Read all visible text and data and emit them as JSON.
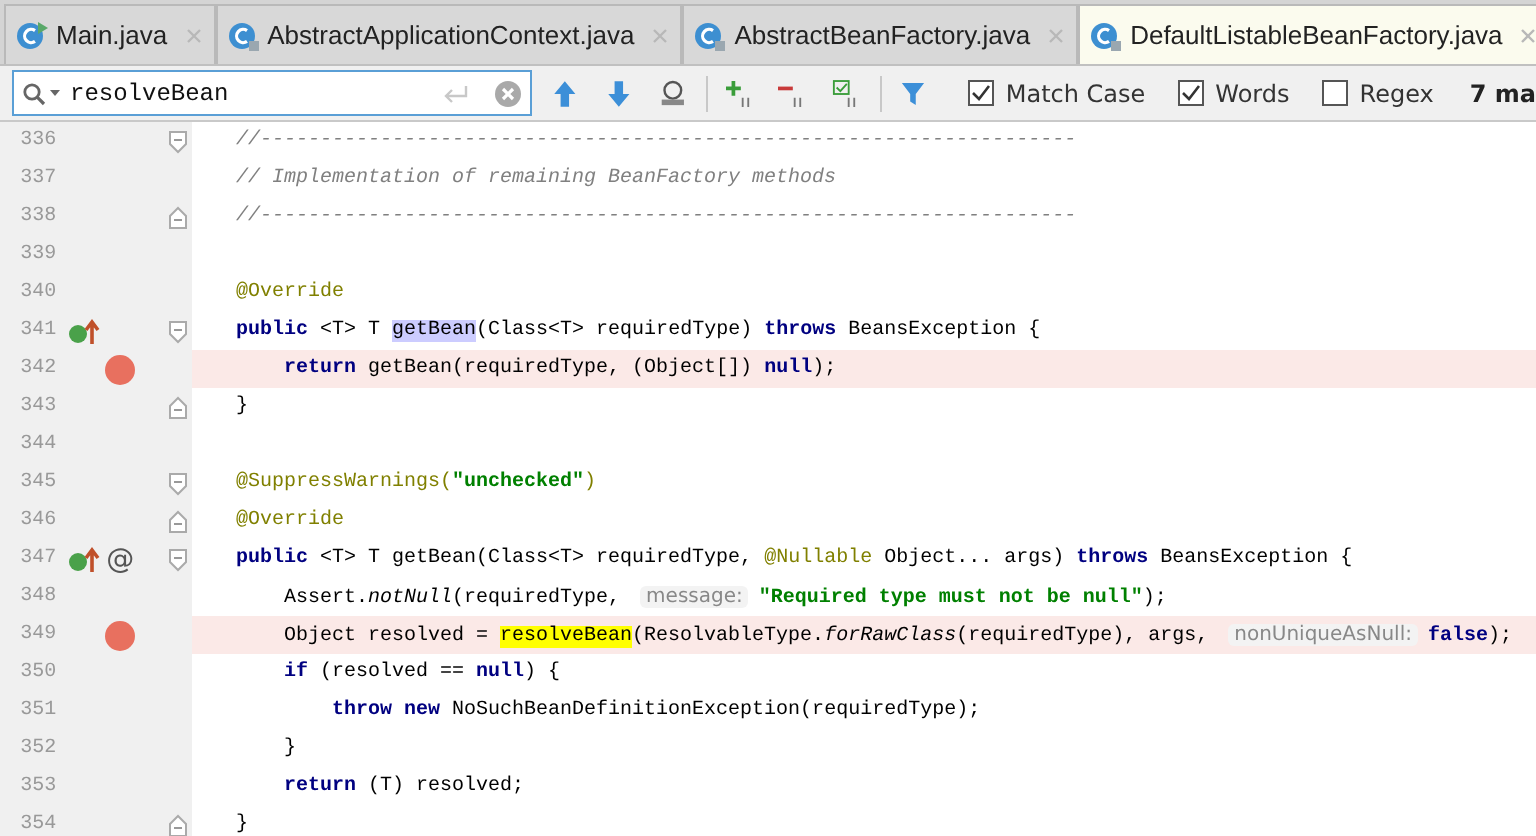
{
  "tabs": [
    {
      "label": "Main.java",
      "selected": false
    },
    {
      "label": "AbstractApplicationContext.java",
      "selected": false
    },
    {
      "label": "AbstractBeanFactory.java",
      "selected": false
    },
    {
      "label": "DefaultListableBeanFactory.java",
      "selected": true
    }
  ],
  "search": {
    "value": "resolveBean",
    "options": [
      {
        "label": "Match Case",
        "checked": true
      },
      {
        "label": "Words",
        "checked": true
      },
      {
        "label": "Regex",
        "checked": false
      }
    ],
    "result": "7 ma"
  },
  "editor": {
    "lines": [
      {
        "number": "336",
        "breakpoint": false,
        "gutter": [
          {
            "kind": "fold-start"
          }
        ],
        "tokens": [
          {
            "kind": "comment",
            "text": "//--------------------------------------------------------------------"
          }
        ]
      },
      {
        "number": "337",
        "breakpoint": false,
        "tokens": [
          {
            "kind": "comment",
            "text": "// Implementation of remaining BeanFactory methods"
          }
        ]
      },
      {
        "number": "338",
        "breakpoint": false,
        "gutter": [
          {
            "kind": "fold-end"
          }
        ],
        "tokens": [
          {
            "kind": "comment",
            "text": "//--------------------------------------------------------------------"
          }
        ]
      },
      {
        "number": "339",
        "breakpoint": false
      },
      {
        "number": "340",
        "breakpoint": false,
        "tokens": [
          {
            "kind": "annotation",
            "text": "@Override"
          }
        ]
      },
      {
        "number": "341",
        "breakpoint": false,
        "gutter": [
          {
            "kind": "override"
          },
          {
            "kind": "fold-start"
          }
        ],
        "tokens": [
          {
            "kind": "keyword",
            "text": "public"
          },
          {
            "kind": "plain",
            "text": " <T> T "
          },
          {
            "kind": "usage",
            "text": "getBean"
          },
          {
            "kind": "plain",
            "text": "(Class<T> requiredType) "
          },
          {
            "kind": "keyword",
            "text": "throws"
          },
          {
            "kind": "plain",
            "text": " BeansException {"
          }
        ]
      },
      {
        "number": "342",
        "breakpoint": true,
        "tokens": [
          {
            "kind": "keyword",
            "text": "    return"
          },
          {
            "kind": "plain",
            "text": " getBean(requiredType, (Object[]) "
          },
          {
            "kind": "keyword",
            "text": "null"
          },
          {
            "kind": "plain",
            "text": ");"
          }
        ]
      },
      {
        "number": "343",
        "breakpoint": false,
        "gutter": [
          {
            "kind": "fold-end"
          }
        ],
        "tokens": [
          {
            "kind": "plain",
            "text": "}"
          }
        ]
      },
      {
        "number": "344",
        "breakpoint": false
      },
      {
        "number": "345",
        "breakpoint": false,
        "gutter": [
          {
            "kind": "fold-start"
          }
        ],
        "tokens": [
          {
            "kind": "annotation",
            "text": "@SuppressWarnings("
          },
          {
            "kind": "string",
            "text": "\"unchecked\""
          },
          {
            "kind": "annotation",
            "text": ")"
          }
        ]
      },
      {
        "number": "346",
        "breakpoint": false,
        "gutter": [
          {
            "kind": "fold-end"
          }
        ],
        "tokens": [
          {
            "kind": "annotation",
            "text": "@Override"
          }
        ]
      },
      {
        "number": "347",
        "breakpoint": false,
        "gutter": [
          {
            "kind": "override"
          },
          {
            "kind": "annotation",
            "text": "@"
          },
          {
            "kind": "fold-start"
          }
        ],
        "tokens": [
          {
            "kind": "keyword",
            "text": "public"
          },
          {
            "kind": "plain",
            "text": " <T> T getBean(Class<T> requiredType, "
          },
          {
            "kind": "annotation",
            "text": "@Nullable"
          },
          {
            "kind": "plain",
            "text": " Object... args) "
          },
          {
            "kind": "keyword",
            "text": "throws"
          },
          {
            "kind": "plain",
            "text": " BeansException {"
          }
        ]
      },
      {
        "number": "348",
        "breakpoint": false,
        "tokens": [
          {
            "kind": "plain",
            "text": "    Assert."
          },
          {
            "kind": "italic",
            "text": "notNull"
          },
          {
            "kind": "plain",
            "text": "(requiredType, "
          },
          {
            "kind": "hint",
            "text": "message:"
          },
          {
            "kind": "string",
            "text": "\"Required type must not be null\""
          },
          {
            "kind": "plain",
            "text": ");"
          }
        ]
      },
      {
        "number": "349",
        "breakpoint": true,
        "tokens": [
          {
            "kind": "plain",
            "text": "    Object resolved = "
          },
          {
            "kind": "match",
            "text": "resolveBean"
          },
          {
            "kind": "plain",
            "text": "(ResolvableType."
          },
          {
            "kind": "italic",
            "text": "forRawClass"
          },
          {
            "kind": "plain",
            "text": "(requiredType), args, "
          },
          {
            "kind": "hint",
            "text": "nonUniqueAsNull:"
          },
          {
            "kind": "keyword",
            "text": "false"
          },
          {
            "kind": "plain",
            "text": ");"
          }
        ]
      },
      {
        "number": "350",
        "breakpoint": false,
        "tokens": [
          {
            "kind": "keyword",
            "text": "    if"
          },
          {
            "kind": "plain",
            "text": " (resolved == "
          },
          {
            "kind": "keyword",
            "text": "null"
          },
          {
            "kind": "plain",
            "text": ") {"
          }
        ]
      },
      {
        "number": "351",
        "breakpoint": false,
        "tokens": [
          {
            "kind": "keyword",
            "text": "        throw"
          },
          {
            "kind": "keyword",
            "text": " new"
          },
          {
            "kind": "plain",
            "text": " NoSuchBeanDefinitionException(requiredType);"
          }
        ]
      },
      {
        "number": "352",
        "breakpoint": false,
        "tokens": [
          {
            "kind": "plain",
            "text": "    }"
          }
        ]
      },
      {
        "number": "353",
        "breakpoint": false,
        "tokens": [
          {
            "kind": "keyword",
            "text": "    return"
          },
          {
            "kind": "plain",
            "text": " (T) resolved;"
          }
        ]
      },
      {
        "number": "354",
        "breakpoint": false,
        "gutter": [
          {
            "kind": "fold-end"
          }
        ],
        "tokens": [
          {
            "kind": "plain",
            "text": "}"
          }
        ]
      }
    ]
  }
}
